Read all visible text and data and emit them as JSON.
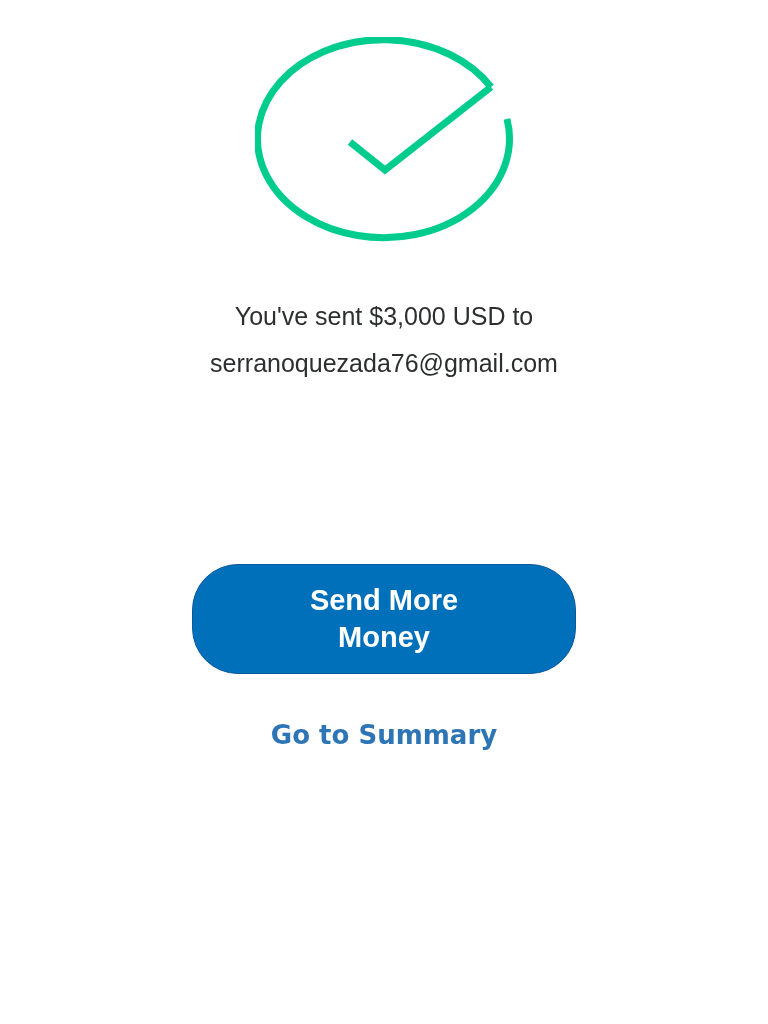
{
  "message": "You've sent $3,000 USD to serranoquezada76@gmail.com",
  "primary_button": "Send More Money",
  "link": "Go to Summary"
}
